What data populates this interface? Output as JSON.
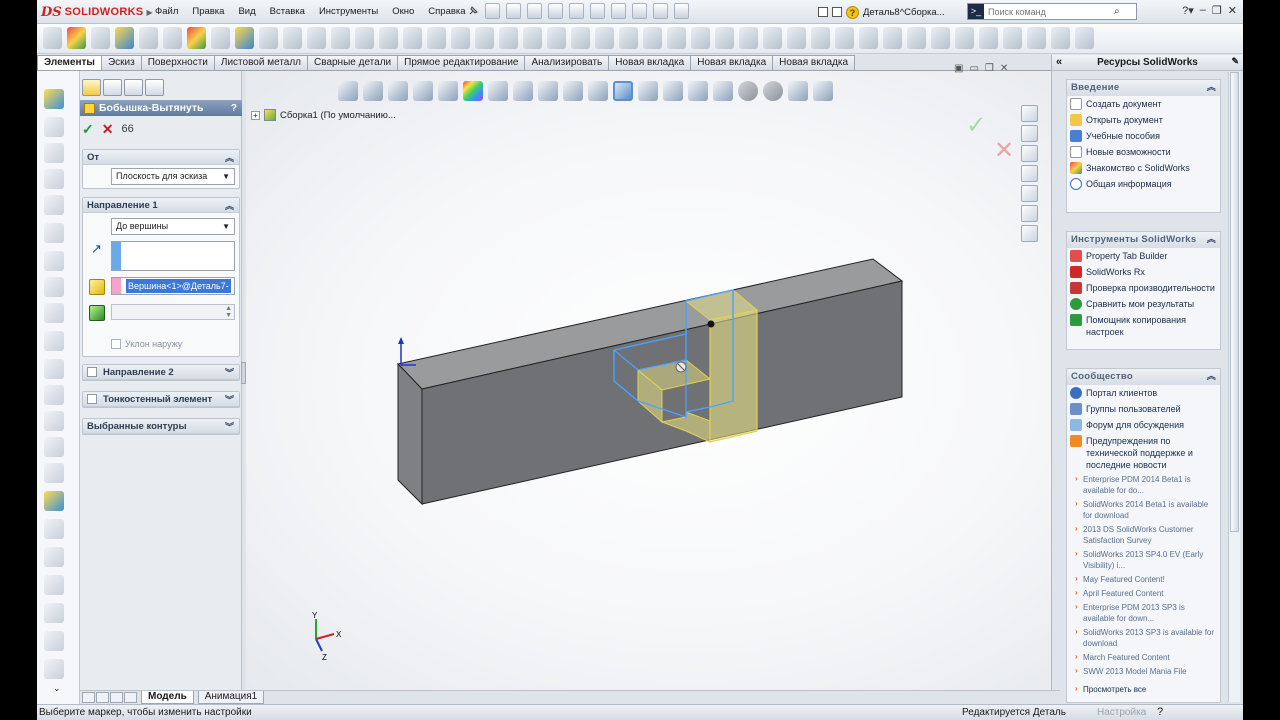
{
  "app": {
    "brand_ds": "DS",
    "brand_name": "SOLIDWORKS",
    "menu": [
      "Файл",
      "Правка",
      "Вид",
      "Вставка",
      "Инструменты",
      "Окно",
      "Справка"
    ],
    "doc_title": "Деталь8^Сборка...",
    "search_placeholder": "Поиск команд"
  },
  "tabs": [
    {
      "label": "Элементы",
      "active": true
    },
    {
      "label": "Эскиз"
    },
    {
      "label": "Поверхности"
    },
    {
      "label": "Листовой металл"
    },
    {
      "label": "Сварные детали"
    },
    {
      "label": "Прямое редактирование"
    },
    {
      "label": "Анализировать"
    },
    {
      "label": "Новая вкладка"
    },
    {
      "label": "Новая вкладка"
    },
    {
      "label": "Новая вкладка"
    }
  ],
  "property_manager": {
    "title": "Бобышка-Вытянуть",
    "help": "?",
    "from": {
      "label": "От",
      "value": "Плоскость для эскиза"
    },
    "direction1": {
      "label": "Направление 1",
      "end_condition": "До вершины",
      "vertex": "Вершина<1>@Деталь7-",
      "draft_outward": "Уклон наружу"
    },
    "direction2": {
      "label": "Направление 2"
    },
    "thin_feature": {
      "label": "Тонкостенный элемент"
    },
    "selected_contours": {
      "label": "Выбранные контуры"
    }
  },
  "graphics": {
    "tree_root": "Сборка1  (По умолчанию..."
  },
  "bottom_tabs": [
    {
      "label": "Модель",
      "active": true
    },
    {
      "label": "Анимация1"
    }
  ],
  "status": {
    "message": "Выберите маркер, чтобы изменить настройки",
    "mode": "Редактируется Деталь",
    "settings": "Настройка"
  },
  "task_pane": {
    "title": "Ресурсы SolidWorks",
    "intro": {
      "header": "Введение",
      "items": [
        "Создать документ",
        "Открыть документ",
        "Учебные пособия",
        "Новые возможности",
        "Знакомство с SolidWorks",
        "Общая информация"
      ]
    },
    "tools": {
      "header": "Инструменты SolidWorks",
      "items": [
        "Property Tab Builder",
        "SolidWorks Rx",
        "Проверка производительности",
        "Сравнить мои результаты",
        "Помощник копирования настроек"
      ]
    },
    "community": {
      "header": "Сообщество",
      "items": [
        "Портал клиентов",
        "Группы пользователей",
        "Форум для обсуждения",
        "Предупреждения по технической поддержке и последние новости"
      ],
      "news": [
        "Enterprise PDM 2014 Beta1 is available for do...",
        "SolidWorks 2014 Beta1 is available for download",
        "2013 DS SolidWorks Customer Satisfaction Survey",
        "SolidWorks 2013 SP4.0 EV (Early Visibility) i...",
        "May Featured Content!",
        "April Featured Content",
        "Enterprise PDM 2013 SP3 is available for down...",
        "SolidWorks 2013 SP3 is available for download",
        "March Featured Content",
        "SWW 2013 Model Mania File"
      ],
      "view_all": "Просмотреть все"
    }
  },
  "colors": {
    "accent": "#5f7aa0",
    "ok": "#1a9a2a",
    "cancel": "#c81d1d",
    "preview": "#f3ea86"
  }
}
